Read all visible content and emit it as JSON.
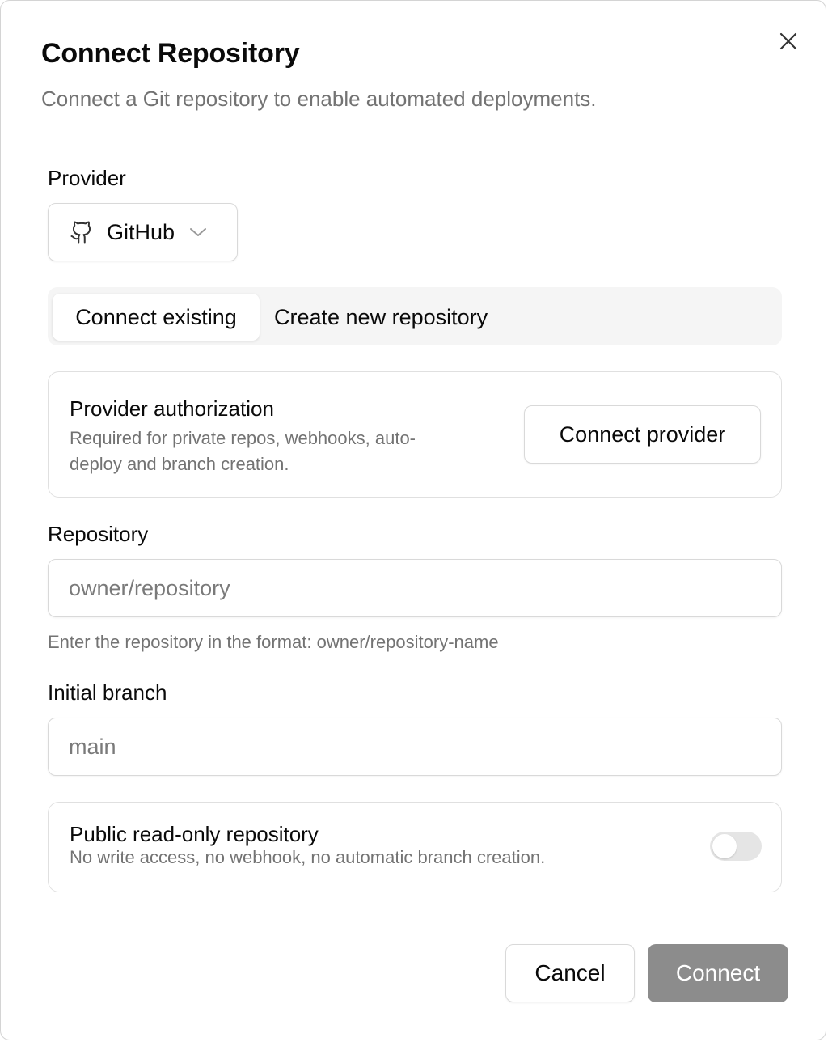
{
  "dialog": {
    "title": "Connect Repository",
    "subtitle": "Connect a Git repository to enable automated deployments."
  },
  "provider": {
    "label": "Provider",
    "selected": "GitHub",
    "icon": "github-icon"
  },
  "tabs": [
    {
      "label": "Connect existing",
      "active": true
    },
    {
      "label": "Create new repository",
      "active": false
    }
  ],
  "authorization": {
    "title": "Provider authorization",
    "description_line1": "Required for private repos, webhooks, auto-",
    "description_line2": "deploy and branch creation.",
    "button_label": "Connect provider"
  },
  "repository": {
    "label": "Repository",
    "placeholder": "owner/repository",
    "value": "",
    "helper": "Enter the repository in the format: owner/repository-name"
  },
  "branch": {
    "label": "Initial branch",
    "placeholder": "main",
    "value": ""
  },
  "public_readonly": {
    "title": "Public read-only repository",
    "description": "No write access, no webhook, no automatic branch creation.",
    "enabled": false
  },
  "footer": {
    "cancel_label": "Cancel",
    "connect_label": "Connect"
  },
  "colors": {
    "primary_disabled": "#8c8c8c",
    "muted_text": "#737373",
    "border": "#d9d9d9",
    "tabs_background": "#f5f5f5"
  }
}
